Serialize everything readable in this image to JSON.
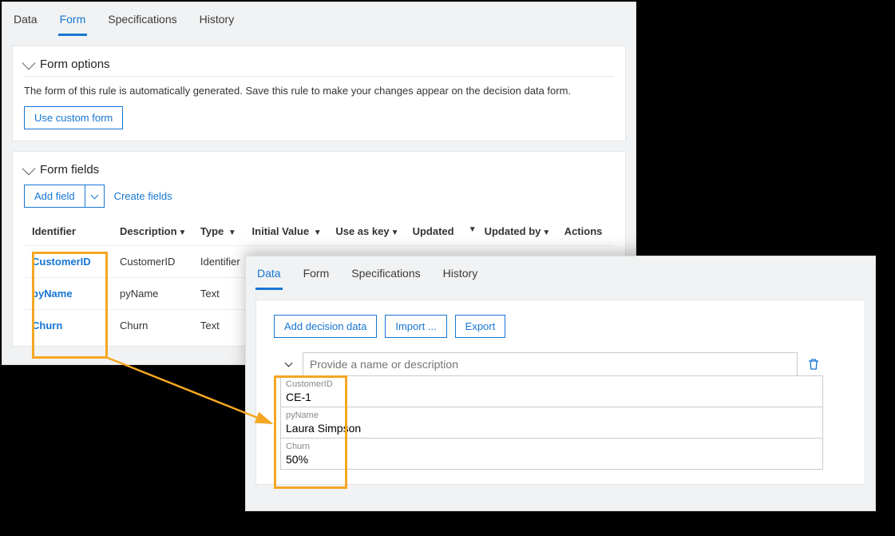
{
  "back": {
    "tabs": [
      "Data",
      "Form",
      "Specifications",
      "History"
    ],
    "activeTab": 1,
    "formOptions": {
      "title": "Form options",
      "desc": "The form of this rule is automatically generated. Save this rule to make your changes appear on the decision data form.",
      "customBtn": "Use custom form"
    },
    "formFields": {
      "title": "Form fields",
      "addBtn": "Add field",
      "createLink": "Create fields",
      "headers": [
        "Identifier",
        "Description",
        "Type",
        "Initial Value",
        "Use as key",
        "Updated",
        "Updated by",
        "Actions"
      ],
      "rows": [
        {
          "id": "CustomerID",
          "desc": "CustomerID",
          "type": "Identifier"
        },
        {
          "id": "pyName",
          "desc": "pyName",
          "type": "Text"
        },
        {
          "id": "Churn",
          "desc": "Churn",
          "type": "Text"
        }
      ]
    }
  },
  "front": {
    "tabs": [
      "Data",
      "Form",
      "Specifications",
      "History"
    ],
    "activeTab": 0,
    "toolbar": {
      "add": "Add decision data",
      "import": "Import ...",
      "export": "Export"
    },
    "namePlaceholder": "Provide a name or description",
    "fields": [
      {
        "label": "CustomerID",
        "value": "CE-1"
      },
      {
        "label": "pyName",
        "value": "Laura Simpson"
      },
      {
        "label": "Churn",
        "value": "50%"
      }
    ]
  }
}
